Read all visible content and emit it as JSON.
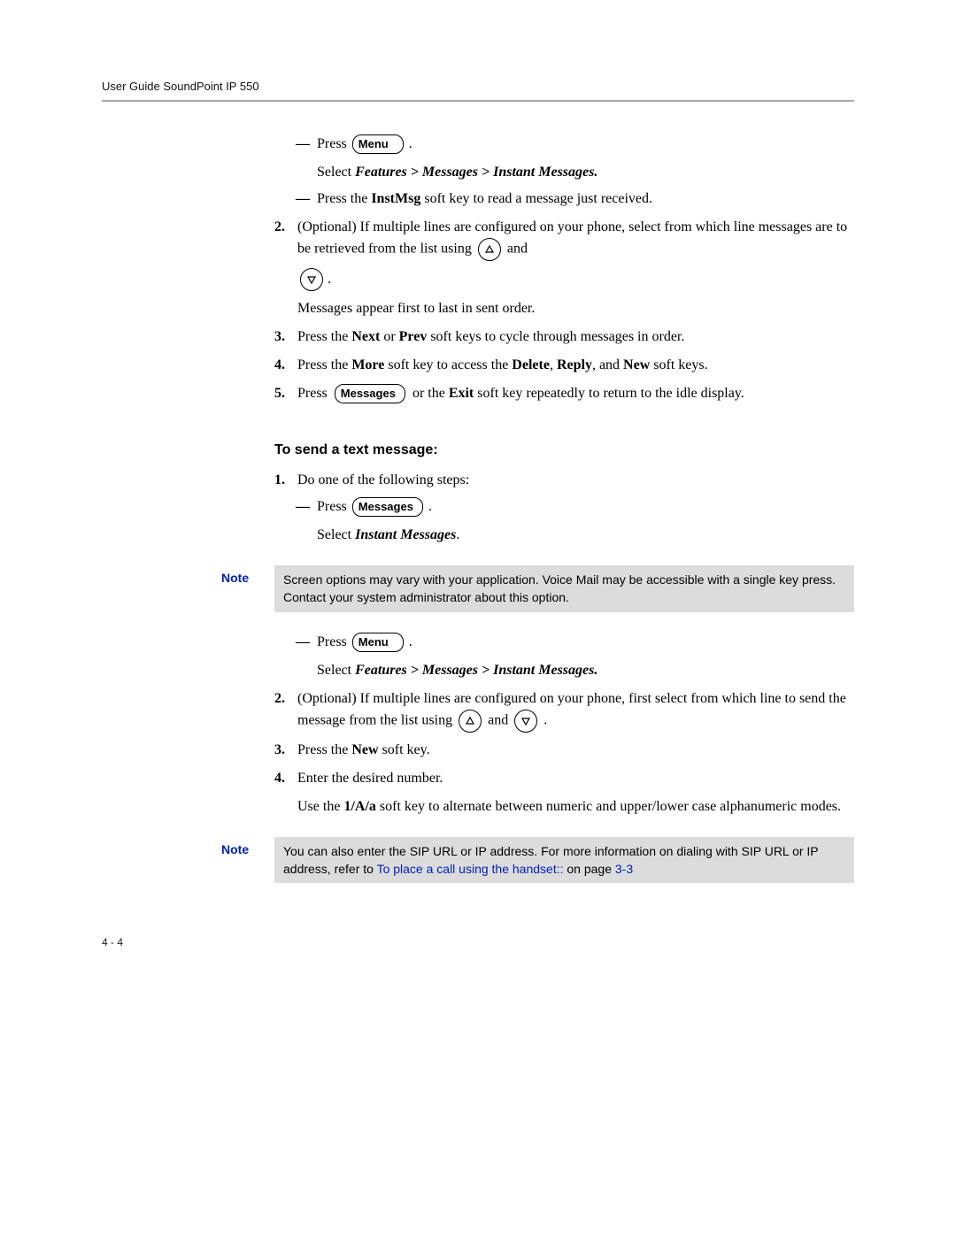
{
  "header": "User Guide SoundPoint IP 550",
  "keys": {
    "menu": "Menu",
    "messages": "Messages"
  },
  "read": {
    "sub_a_press": "Press",
    "sub_a_period": ".",
    "sub_a_select": "Select ",
    "sub_a_select_path": "Features > Messages > Instant Messages.",
    "sub_b_1": "Press the ",
    "sub_b_bold": "InstMsg",
    "sub_b_2": " soft key to read a message just received.",
    "step2_a": "(Optional) If multiple lines are configured on your phone, select from which line messages are to be retrieved from the list using",
    "step2_and": "and",
    "step2_period": ".",
    "step2_b": "Messages appear first to last in sent order.",
    "step3_a": "Press the ",
    "step3_next": "Next",
    "step3_or": " or ",
    "step3_prev": "Prev",
    "step3_b": " soft keys to cycle through messages in order.",
    "step4_a": "Press the ",
    "step4_more": "More",
    "step4_b": " soft key to access the ",
    "step4_delete": "Delete",
    "step4_c": ", ",
    "step4_reply": "Reply",
    "step4_d": ", and ",
    "step4_new": "New",
    "step4_e": " soft keys.",
    "step5_press": "Press",
    "step5_a": "or the ",
    "step5_exit": "Exit",
    "step5_b": " soft key repeatedly to return to the idle display."
  },
  "send": {
    "heading": "To send a text message:",
    "step1": "Do one of the following steps:",
    "sub_a_press": "Press",
    "sub_a_period": ".",
    "sub_a_select_pre": "Select ",
    "sub_a_select_bold": "Instant Messages",
    "sub_a_select_post": ".",
    "note1_label": "Note",
    "note1_text": "Screen options may vary with your application. Voice Mail may be accessible with a single key press. Contact your system administrator about this option.",
    "sub_b_press": "Press",
    "sub_b_period": ".",
    "sub_b_select_pre": "Select ",
    "sub_b_select_bold": "Features > Messages > Instant Messages.",
    "step2_a": "(Optional) If multiple lines are configured on your phone, first select from which line to send the message from the list using",
    "step2_and": "and",
    "step2_period": ".",
    "step3_a": "Press the ",
    "step3_new": "New",
    "step3_b": " soft key.",
    "step4": "Enter the desired number.",
    "step4_b_a": "Use the ",
    "step4_b_bold": "1/A/a",
    "step4_b_b": " soft key to alternate between numeric and upper/lower case alphanumeric modes.",
    "note2_label": "Note",
    "note2_a": "You can also enter the SIP URL or IP address. For more information on dialing with SIP URL or IP address, refer to ",
    "note2_link": "To place a call using the handset::",
    "note2_b": " on page ",
    "note2_page": "3-3"
  },
  "nums": {
    "n2": "2.",
    "n3": "3.",
    "n4": "4.",
    "n5": "5.",
    "n1": "1."
  },
  "footer": "4 - 4"
}
